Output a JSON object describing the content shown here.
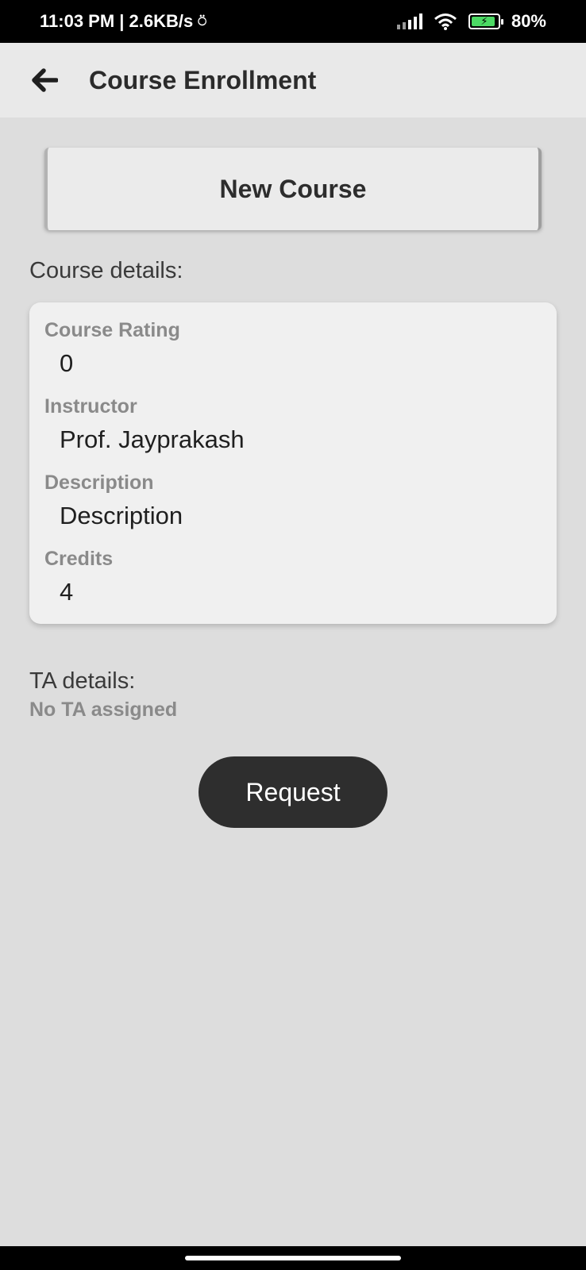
{
  "status_bar": {
    "time_speed": "11:03 PM | 2.6KB/s",
    "battery": "80%"
  },
  "app_bar": {
    "back_icon": "arrow-left-icon",
    "title": "Course Enrollment"
  },
  "course_button_label": "New Course",
  "course_section_label": "Course details:",
  "course_details": [
    {
      "label": "Course Rating",
      "value": "0"
    },
    {
      "label": "Instructor",
      "value": "Prof. Jayprakash"
    },
    {
      "label": "Description",
      "value": "Description"
    },
    {
      "label": "Credits",
      "value": "4"
    }
  ],
  "ta_section_label": "TA details:",
  "ta_empty_text": "No TA assigned",
  "request_button_label": "Request",
  "colors": {
    "background": "#dddddd",
    "app_bar": "#e9e9e9",
    "card": "#f0f0f0",
    "muted_label": "#8a8a8a",
    "primary_button": "#2e2e2e"
  }
}
